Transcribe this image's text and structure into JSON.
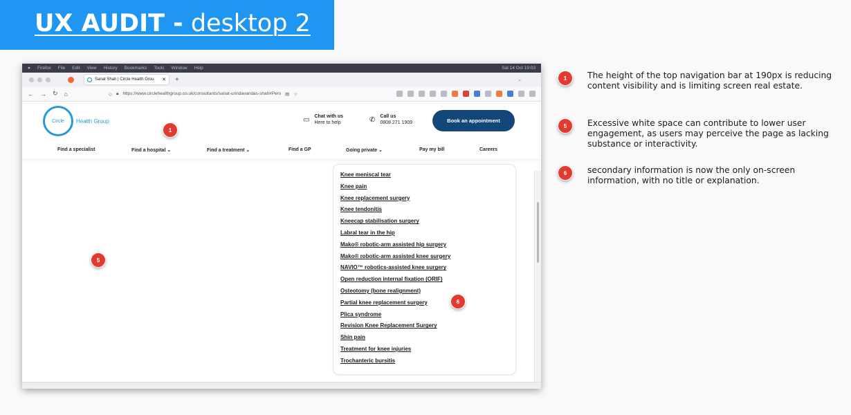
{
  "title": {
    "bold": "UX AUDIT -",
    "light": " desktop 2"
  },
  "browser": {
    "menubar": [
      "Firefox",
      "File",
      "Edit",
      "View",
      "History",
      "Bookmarks",
      "Tools",
      "Window",
      "Help"
    ],
    "clock": "Sat 14 Oct 19:03",
    "tab_title": "Sanat Shah | Circle Health Grou",
    "url": "https://www.circlehealthgroup.co.uk/consultants/sanat-urindavandas-shah#Pers"
  },
  "site": {
    "logo_word": "Circle",
    "logo_text": "Health Group",
    "chat": {
      "title": "Chat with us",
      "sub": "Here to help"
    },
    "call": {
      "title": "Call us",
      "number": "0808 271 1909"
    },
    "book_button": "Book an appointment",
    "nav": [
      "Find a specialist",
      "Find a hospital ⌄",
      "Find a treatment ⌄",
      "Find a GP",
      "Going private ⌄",
      "Pay my bill",
      "Careers"
    ]
  },
  "treatment_links": [
    "Knee meniscal tear",
    "Knee pain",
    "Knee replacement surgery",
    "Knee tendonitis",
    "Kneecap stabilisation surgery",
    "Labral tear in the hip",
    "Mako® robotic-arm assisted hip surgery",
    "Mako® robotic-arm assisted knee surgery",
    "NAVIO™ robotics-assisted knee surgery",
    "Open reduction internal fixation (ORIF)",
    "Osteotomy (bone realignment)",
    "Partial knee replacement surgery",
    "Plica syndrome",
    "Revision Knee Replacement Surgery",
    "Shin pain",
    "Treatment for knee injuries",
    "Trochanteric bursitis"
  ],
  "markers": {
    "header": "1",
    "whitespace": "5",
    "list": "6"
  },
  "notes": [
    {
      "number": "1",
      "text": "The height of the top navigation bar at 190px is reducing content visibility and is limiting screen real estate."
    },
    {
      "number": "5",
      "text": "Excessive white space can contribute to lower user engagement, as users may perceive the page as lacking substance or interactivity."
    },
    {
      "number": "6",
      "text": "secondary information is now the only on-screen information, with no title or explanation."
    }
  ],
  "colors": {
    "banner": "#1f97f2",
    "marker": "#e23a2e",
    "brand_blue": "#2799d8",
    "button_navy": "#13477a"
  }
}
